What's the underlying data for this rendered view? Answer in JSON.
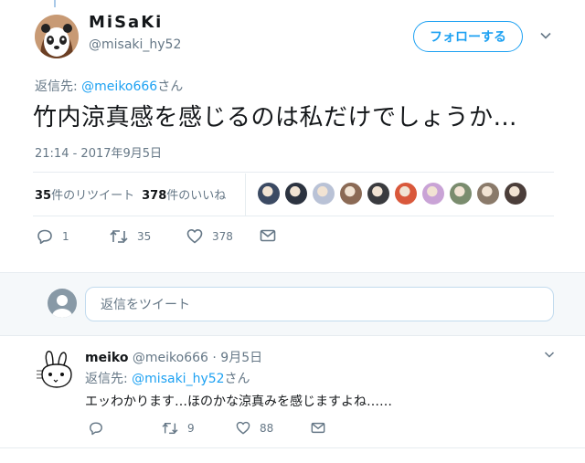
{
  "tweet": {
    "display_name": "MiSaKi",
    "screen_name": "@misaki_hy52",
    "follow_label": "フォローする",
    "reply_to_prefix": "返信先: ",
    "reply_to_handle": "@meiko666",
    "reply_to_suffix": "さん",
    "text": "竹内涼真感を感じるのは私だけでしょうか…",
    "timestamp": "21:14 - 2017年9月5日",
    "retweet_count": "35",
    "retweet_label": "件のリツイート",
    "like_count": "378",
    "like_label": "件のいいね",
    "actions": {
      "reply": "1",
      "retweet": "35",
      "like": "378"
    }
  },
  "liker_colors": [
    "#3b4a63",
    "#2c3340",
    "#b9c2d6",
    "#8b6a55",
    "#3a3b3f",
    "#d9583b",
    "#c9a3d6",
    "#7a8c6e",
    "#8a7a6a",
    "#4b3e3a"
  ],
  "reply_box": {
    "placeholder": "返信をツイート"
  },
  "reply": {
    "name": "meiko",
    "handle": "@meiko666",
    "date": "· 9月5日",
    "reply_to_prefix": "返信先: ",
    "reply_to_handle": "@misaki_hy52",
    "reply_to_suffix": "さん",
    "text": "エッわかります…ほのかな涼真みを感じますよね……",
    "actions": {
      "retweet": "9",
      "like": "88"
    }
  },
  "colors": {
    "accent": "#1da1f2",
    "muted": "#657786"
  }
}
